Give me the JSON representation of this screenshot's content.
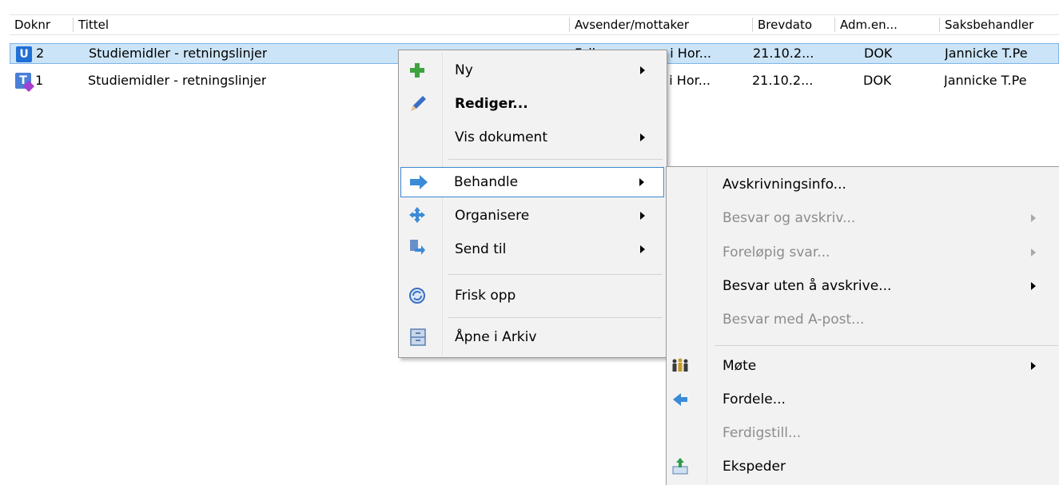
{
  "table": {
    "columns": [
      "Doknr",
      "Tittel",
      "Avsender/mottaker",
      "Brevdato",
      "Adm.en...",
      "Saksbehandler"
    ],
    "rows": [
      {
        "icon": "U",
        "doknr": "2",
        "tittel": "Studiemidler - retningslinjer",
        "avsender": "Fylkesmannen i Hor...",
        "brevdato": "21.10.2...",
        "adm": "DOK",
        "saksbehandler": "Jannicke T.Pe"
      },
      {
        "icon": "T",
        "doknr": "1",
        "tittel": "Studiemidler - retningslinjer",
        "avsender": "Fylkesmannen i Hor...",
        "brevdato": "21.10.2...",
        "adm": "DOK",
        "saksbehandler": "Jannicke T.Pe"
      }
    ],
    "partial_avsender_row1": "Fylkesmannen i Hor...",
    "visible_avsender_row2": "nen i Hor..."
  },
  "context_menu": {
    "items": [
      {
        "label": "Ny",
        "icon": "plus-icon",
        "submenu": true
      },
      {
        "label": "Rediger...",
        "icon": "pencil-icon",
        "bold": true
      },
      {
        "label": "Vis dokument",
        "submenu": true
      },
      {
        "label": "Behandle",
        "icon": "arrow-right-icon",
        "submenu": true,
        "highlighted": true
      },
      {
        "label": "Organisere",
        "icon": "move-icon",
        "submenu": true
      },
      {
        "label": "Send til",
        "icon": "send-icon",
        "submenu": true
      },
      {
        "label": "Frisk opp",
        "icon": "refresh-icon"
      },
      {
        "label": "Åpne i Arkiv",
        "icon": "archive-icon"
      }
    ]
  },
  "submenu": {
    "items": [
      {
        "label": "Avskrivningsinfo...",
        "enabled": true
      },
      {
        "label": "Besvar og avskriv...",
        "enabled": false,
        "submenu": true
      },
      {
        "label": "Foreløpig svar...",
        "enabled": false,
        "submenu": true
      },
      {
        "label": "Besvar uten å avskrive...",
        "enabled": true,
        "submenu": true
      },
      {
        "label": "Besvar med A-post...",
        "enabled": false
      },
      {
        "label": "Møte",
        "enabled": true,
        "submenu": true,
        "icon": "people-icon"
      },
      {
        "label": "Fordele...",
        "enabled": true,
        "icon": "share-icon"
      },
      {
        "label": "Ferdigstill...",
        "enabled": false
      },
      {
        "label": "Ekspeder",
        "enabled": true,
        "icon": "dispatch-icon"
      }
    ]
  },
  "colors": {
    "selection": "#cce4f7",
    "selection_border": "#7eb4ea",
    "highlight_border": "#3c87d0"
  }
}
